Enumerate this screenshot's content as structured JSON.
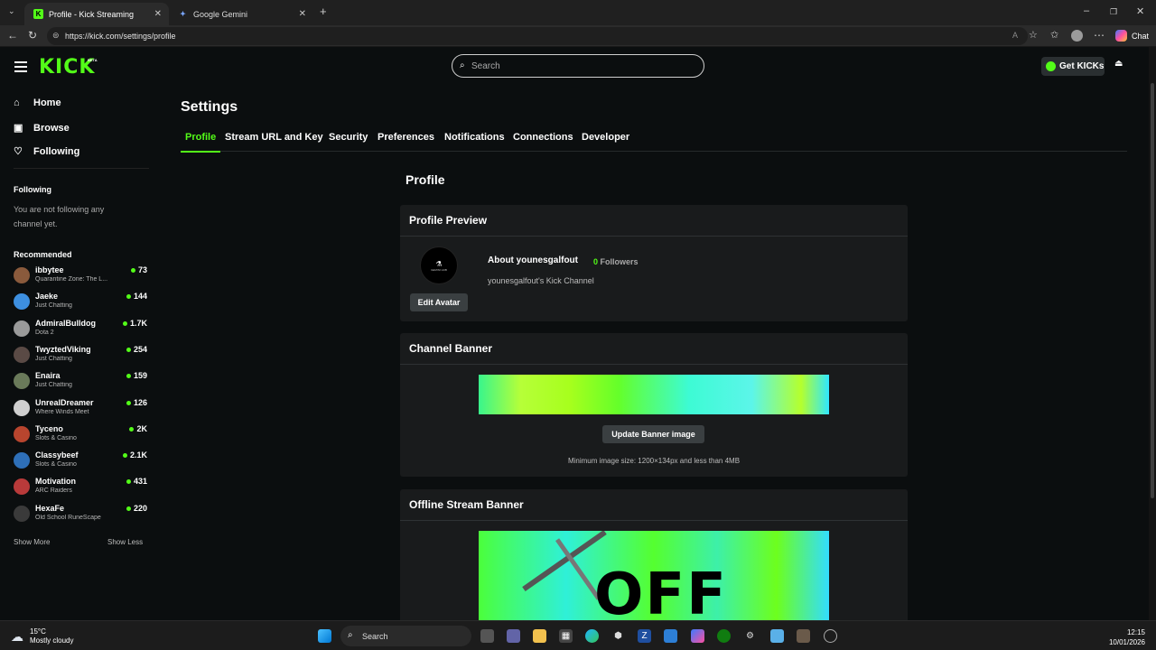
{
  "browser": {
    "tabs": [
      {
        "title": "Profile - Kick Streaming",
        "active": true
      },
      {
        "title": "Google Gemini",
        "active": false
      }
    ],
    "url": "https://kick.com/settings/profile",
    "chat_label": "Chat"
  },
  "header": {
    "logo": "KICK",
    "beta": "BETA",
    "search_placeholder": "Search",
    "get_kicks": "Get KICKs"
  },
  "sidebar": {
    "nav": [
      "Home",
      "Browse",
      "Following"
    ],
    "following_title": "Following",
    "following_empty": "You are not following any channel yet.",
    "recommended_title": "Recommended",
    "recommended": [
      {
        "name": "ibbytee",
        "category": "Quarantine Zone: The L...",
        "viewers": "73",
        "color": "#8a5a3c"
      },
      {
        "name": "Jaeke",
        "category": "Just Chatting",
        "viewers": "144",
        "color": "#3d8fe0"
      },
      {
        "name": "AdmiralBulldog",
        "category": "Dota 2",
        "viewers": "1.7K",
        "color": "#9a9a9a"
      },
      {
        "name": "TwyztedViking",
        "category": "Just Chatting",
        "viewers": "254",
        "color": "#5a4a45"
      },
      {
        "name": "Enaira",
        "category": "Just Chatting",
        "viewers": "159",
        "color": "#6a7a5a"
      },
      {
        "name": "UnrealDreamer",
        "category": "Where Winds Meet",
        "viewers": "126",
        "color": "#cfcfcf"
      },
      {
        "name": "Tyceno",
        "category": "Slots & Casino",
        "viewers": "2K",
        "color": "#b8452e"
      },
      {
        "name": "Classybeef",
        "category": "Slots & Casino",
        "viewers": "2.1K",
        "color": "#2e6fb8"
      },
      {
        "name": "Motivation",
        "category": "ARC Raiders",
        "viewers": "431",
        "color": "#b83a3a"
      },
      {
        "name": "HexaFe",
        "category": "Old School RuneScape",
        "viewers": "220",
        "color": "#3a3a3a"
      }
    ],
    "show_more": "Show More",
    "show_less": "Show Less"
  },
  "settings": {
    "title": "Settings",
    "tabs": [
      "Profile",
      "Stream URL and Key",
      "Security",
      "Preferences",
      "Notifications",
      "Connections",
      "Developer"
    ],
    "section_heading": "Profile",
    "preview": {
      "title": "Profile Preview",
      "avatar_text": "GEMINI HUB",
      "edit_avatar": "Edit Avatar",
      "about": "About younesgalfout",
      "followers_count": "0",
      "followers_label": "Followers",
      "description": "younesgalfout's Kick Channel"
    },
    "banner": {
      "title": "Channel Banner",
      "update_button": "Update Banner image",
      "hint": "Minimum image size: 1200×134px and less than 4MB"
    },
    "offline": {
      "title": "Offline Stream Banner",
      "image_text": "OFF"
    }
  },
  "taskbar": {
    "weather_temp": "15°C",
    "weather_desc": "Mostly cloudy",
    "search": "Search",
    "time": "12:15",
    "date": "10/01/2026"
  },
  "colors": {
    "accent": "#53fc18",
    "background": "#0b0e0f",
    "card": "#191b1c"
  }
}
